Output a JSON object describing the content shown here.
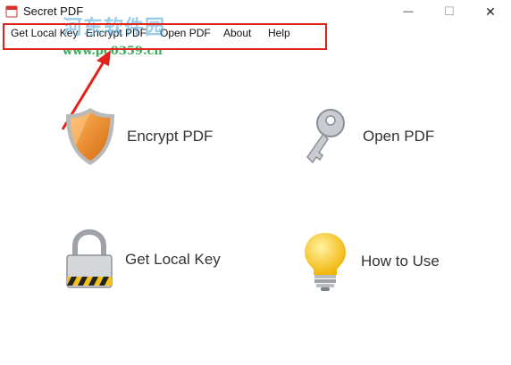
{
  "window": {
    "title": "Secret PDF",
    "minimize_glyph": "—",
    "maximize_glyph": "☐",
    "close_glyph": "✕"
  },
  "menu": {
    "items": [
      "Get Local Key",
      "Encrypt PDF",
      "Open PDF",
      "About",
      "Help"
    ]
  },
  "watermark": {
    "text": "河东软件园",
    "url": "www.pc0359.cn"
  },
  "tiles": [
    {
      "label": "Encrypt PDF",
      "icon": "shield-icon"
    },
    {
      "label": "Open PDF",
      "icon": "key-icon"
    },
    {
      "label": "Get Local Key",
      "icon": "padlock-icon"
    },
    {
      "label": "How to Use",
      "icon": "lightbulb-icon"
    }
  ],
  "colors": {
    "highlight": "#e2231a",
    "shield": "#f08a24",
    "bulb": "#f7c71c"
  }
}
